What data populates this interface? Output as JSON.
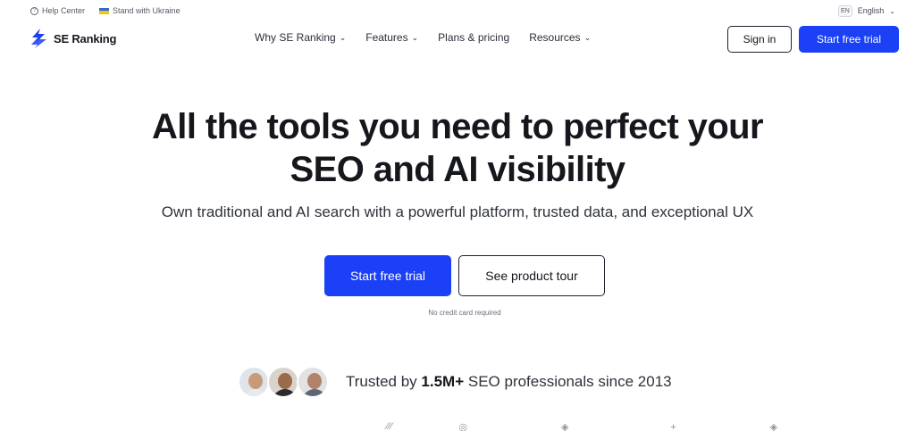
{
  "utility": {
    "help_label": "Help Center",
    "ukraine_label": "Stand with Ukraine",
    "lang_code": "EN",
    "lang_label": "English"
  },
  "nav": {
    "logo_text": "SE Ranking",
    "links": [
      {
        "label": "Why SE Ranking",
        "has_dropdown": true
      },
      {
        "label": "Features",
        "has_dropdown": true
      },
      {
        "label": "Plans & pricing",
        "has_dropdown": false
      },
      {
        "label": "Resources",
        "has_dropdown": true
      }
    ],
    "signin_label": "Sign in",
    "trial_label": "Start free trial"
  },
  "hero": {
    "title_line1": "All the tools you need to perfect your",
    "title_line2": "SEO and AI visibility",
    "subtitle": "Own traditional and AI search with a powerful platform, trusted data, and exceptional UX",
    "primary_cta": "Start free trial",
    "secondary_cta": "See product tour",
    "note": "No credit card required"
  },
  "trust": {
    "prefix": "Trusted by ",
    "highlight": "1.5M+",
    "suffix": " SEO professionals since 2013"
  },
  "colors": {
    "accent": "#1b40f5",
    "text": "#15171d"
  },
  "icons": {
    "help": "help-circle-icon",
    "flag": "ukraine-flag-icon",
    "chevron": "chevron-down-icon"
  }
}
